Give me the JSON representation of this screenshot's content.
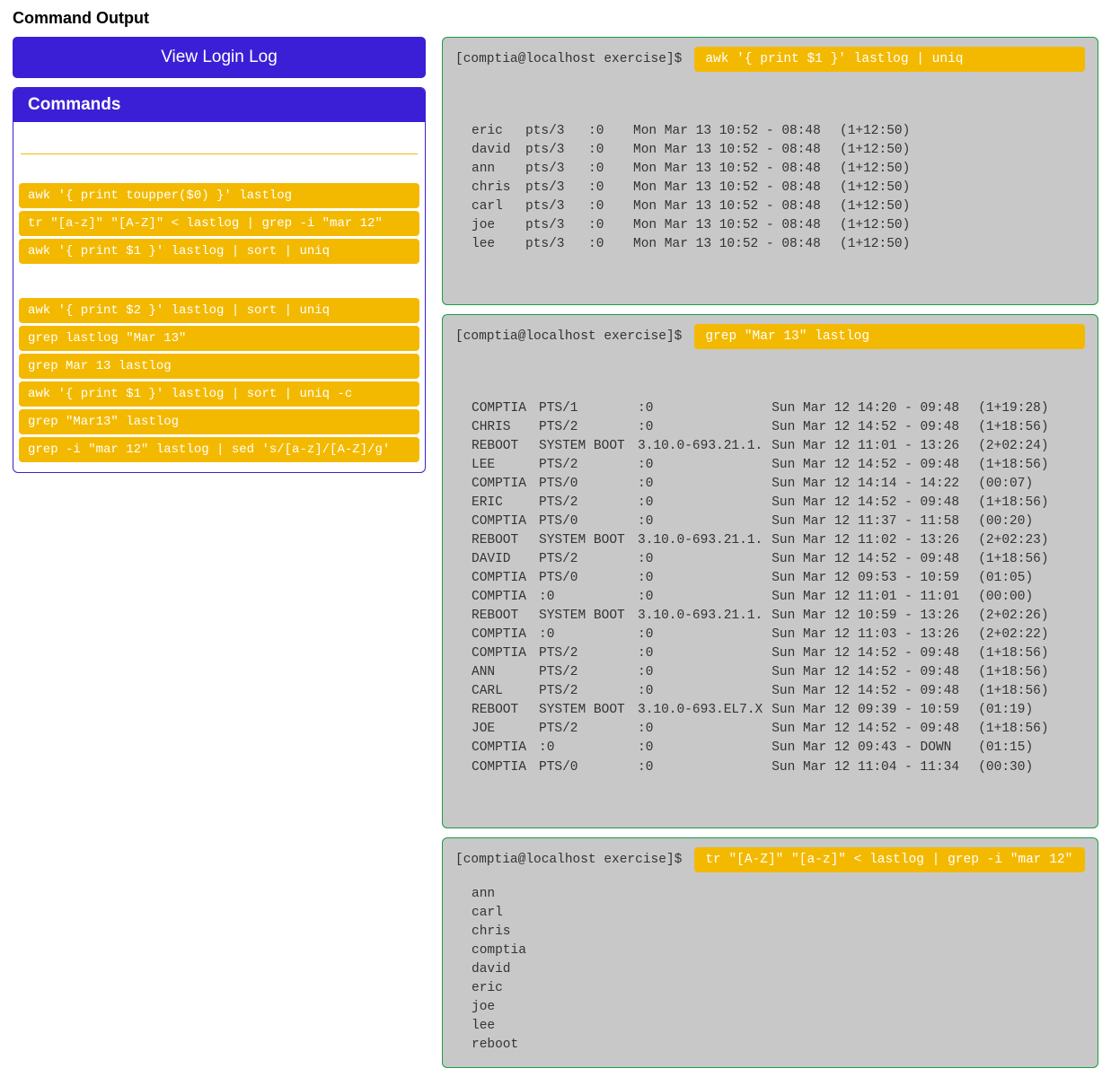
{
  "title": "Command Output",
  "view_log_button": "View Login Log",
  "commands_header": "Commands",
  "command_pills": [
    "awk '{ print toupper($0) }' lastlog",
    "tr \"[a-z]\" \"[A-Z]\" < lastlog | grep -i \"mar 12\"",
    "awk '{ print $1 }' lastlog | sort | uniq",
    "awk '{ print $2 }' lastlog | sort | uniq",
    "grep lastlog \"Mar 13\"",
    "grep Mar 13 lastlog",
    "awk '{ print $1 }' lastlog | sort | uniq -c",
    "grep \"Mar13\" lastlog",
    "grep -i \"mar 12\" lastlog | sed 's/[a-z]/[A-Z]/g'"
  ],
  "prompt": "[comptia@localhost exercise]$",
  "terminals": [
    {
      "command": "awk '{ print $1 }' lastlog | uniq",
      "rows": [
        [
          "eric",
          "pts/3",
          ":0",
          "Mon Mar 13 10:52 - 08:48",
          "(1+12:50)"
        ],
        [
          "david",
          "pts/3",
          ":0",
          "Mon Mar 13 10:52 - 08:48",
          "(1+12:50)"
        ],
        [
          "ann",
          "pts/3",
          ":0",
          "Mon Mar 13 10:52 - 08:48",
          "(1+12:50)"
        ],
        [
          "chris",
          "pts/3",
          ":0",
          "Mon Mar 13 10:52 - 08:48",
          "(1+12:50)"
        ],
        [
          "carl",
          "pts/3",
          ":0",
          "Mon Mar 13 10:52 - 08:48",
          "(1+12:50)"
        ],
        [
          "joe",
          "pts/3",
          ":0",
          "Mon Mar 13 10:52 - 08:48",
          "(1+12:50)"
        ],
        [
          "lee",
          "pts/3",
          ":0",
          "Mon Mar 13 10:52 - 08:48",
          "(1+12:50)"
        ]
      ]
    },
    {
      "command": "grep \"Mar 13\" lastlog",
      "rows": [
        [
          "COMPTIA",
          "PTS/1",
          ":0",
          "Sun Mar 12 14:20 - 09:48",
          "(1+19:28)"
        ],
        [
          "CHRIS",
          "PTS/2",
          ":0",
          "Sun Mar 12 14:52 - 09:48",
          "(1+18:56)"
        ],
        [
          "REBOOT",
          "SYSTEM BOOT",
          "3.10.0-693.21.1.",
          "Sun Mar 12 11:01 - 13:26",
          "(2+02:24)"
        ],
        [
          "LEE",
          "PTS/2",
          ":0",
          "Sun Mar 12 14:52 - 09:48",
          "(1+18:56)"
        ],
        [
          "COMPTIA",
          "PTS/0",
          ":0",
          "Sun Mar 12 14:14 - 14:22",
          "(00:07)"
        ],
        [
          "ERIC",
          "PTS/2",
          ":0",
          "Sun Mar 12 14:52 - 09:48",
          "(1+18:56)"
        ],
        [
          "COMPTIA",
          "PTS/0",
          ":0",
          "Sun Mar 12 11:37 - 11:58",
          "(00:20)"
        ],
        [
          "REBOOT",
          "SYSTEM BOOT",
          "3.10.0-693.21.1.",
          "Sun Mar 12 11:02 - 13:26",
          "(2+02:23)"
        ],
        [
          "DAVID",
          "PTS/2",
          ":0",
          "Sun Mar 12 14:52 - 09:48",
          "(1+18:56)"
        ],
        [
          "COMPTIA",
          "PTS/0",
          ":0",
          "Sun Mar 12 09:53 - 10:59",
          "(01:05)"
        ],
        [
          "COMPTIA",
          ":0",
          ":0",
          "Sun Mar 12 11:01 - 11:01",
          "(00:00)"
        ],
        [
          "REBOOT",
          "SYSTEM BOOT",
          "3.10.0-693.21.1.",
          "Sun Mar 12 10:59 - 13:26",
          "(2+02:26)"
        ],
        [
          "COMPTIA",
          ":0",
          ":0",
          "Sun Mar 12 11:03 - 13:26",
          "(2+02:22)"
        ],
        [
          "COMPTIA",
          "PTS/2",
          ":0",
          "Sun Mar 12 14:52 - 09:48",
          "(1+18:56)"
        ],
        [
          "ANN",
          "PTS/2",
          ":0",
          "Sun Mar 12 14:52 - 09:48",
          "(1+18:56)"
        ],
        [
          "CARL",
          "PTS/2",
          ":0",
          "Sun Mar 12 14:52 - 09:48",
          "(1+18:56)"
        ],
        [
          "REBOOT",
          "SYSTEM BOOT",
          "3.10.0-693.EL7.X",
          "Sun Mar 12 09:39 - 10:59",
          "(01:19)"
        ],
        [
          "JOE",
          "PTS/2",
          ":0",
          "Sun Mar 12 14:52 - 09:48",
          "(1+18:56)"
        ],
        [
          "COMPTIA",
          ":0",
          ":0",
          "Sun Mar 12 09:43 - DOWN",
          "(01:15)"
        ],
        [
          "COMPTIA",
          "PTS/0",
          ":0",
          "Sun Mar 12 11:04 - 11:34",
          "(00:30)"
        ]
      ]
    },
    {
      "command": "tr \"[A-Z]\" \"[a-z]\" < lastlog | grep -i \"mar 12\"",
      "lines": [
        "ann",
        "carl",
        "chris",
        "comptia",
        "david",
        "eric",
        "joe",
        "lee",
        "reboot"
      ]
    }
  ]
}
